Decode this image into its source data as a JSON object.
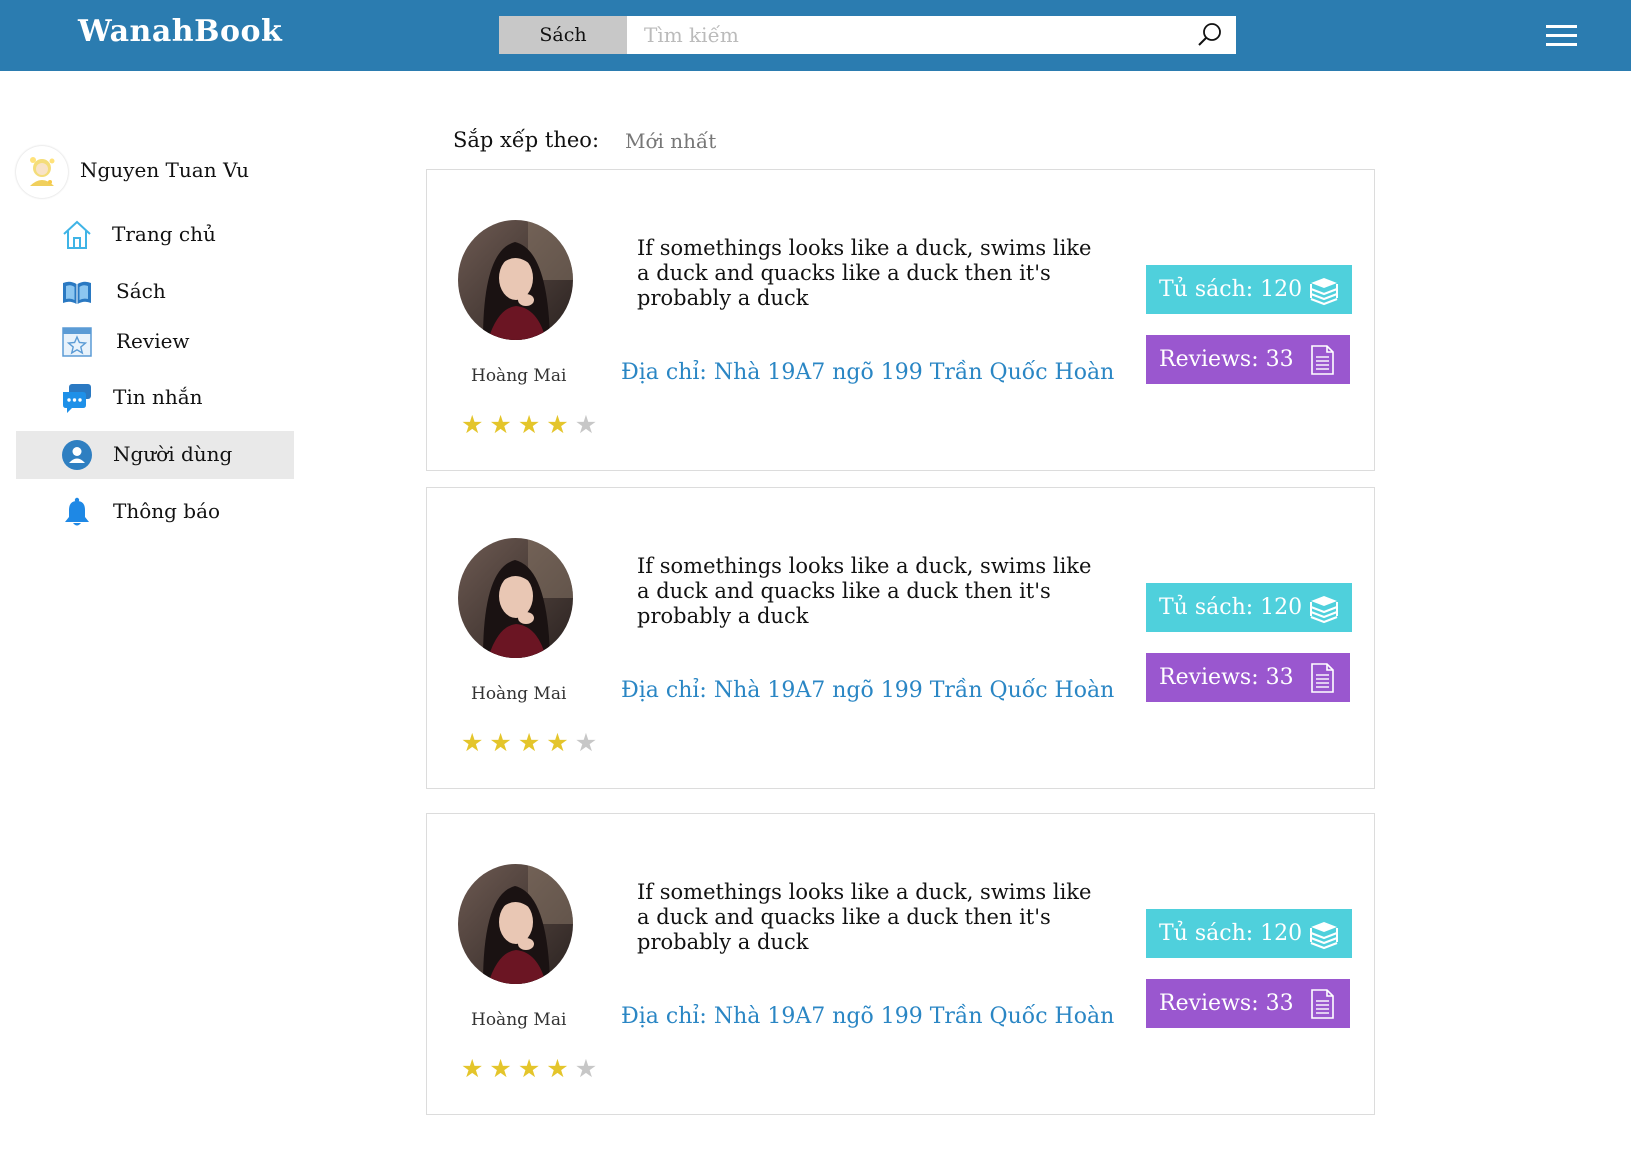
{
  "header": {
    "logo": "WanahBook",
    "search_category": "Sách",
    "search_placeholder": "Tìm kiếm"
  },
  "sidebar": {
    "profile_name": "Nguyen Tuan Vu",
    "items": [
      {
        "label": "Trang chủ",
        "icon": "home-icon"
      },
      {
        "label": "Sách",
        "icon": "book-icon"
      },
      {
        "label": "Review",
        "icon": "review-star-icon"
      },
      {
        "label": "Tin nhắn",
        "icon": "chat-icon"
      },
      {
        "label": "Người dùng",
        "icon": "user-icon",
        "active": true
      },
      {
        "label": "Thông báo",
        "icon": "bell-icon"
      }
    ]
  },
  "sort": {
    "label": "Sắp xếp theo:",
    "value": "Mới nhất"
  },
  "users": [
    {
      "name": "Hoàng Mai",
      "quote": "If somethings looks like a duck, swims like a duck and quacks like a duck then it's probably a duck",
      "address": "Địa chỉ: Nhà 19A7 ngõ 199 Trần Quốc Hoàn",
      "shelf": "Tủ sách: 120",
      "reviews": "Reviews: 33",
      "rating": 4,
      "rating_max": 5
    },
    {
      "name": "Hoàng Mai",
      "quote": "If somethings looks like a duck, swims like a duck and quacks like a duck then it's probably a duck",
      "address": "Địa chỉ: Nhà 19A7 ngõ 199 Trần Quốc Hoàn",
      "shelf": "Tủ sách: 120",
      "reviews": "Reviews: 33",
      "rating": 4,
      "rating_max": 5
    },
    {
      "name": "Hoàng Mai",
      "quote": "If somethings looks like a duck, swims like a duck and quacks like a duck then it's probably a duck",
      "address": "Địa chỉ: Nhà 19A7 ngõ 199 Trần Quốc Hoàn",
      "shelf": "Tủ sách: 120",
      "reviews": "Reviews: 33",
      "rating": 4,
      "rating_max": 5
    }
  ],
  "colors": {
    "header": "#2b7cb0",
    "shelf_button": "#4fd0dc",
    "reviews_button": "#9a57cf",
    "address": "#2a86c4",
    "star": "#e4c52b"
  }
}
